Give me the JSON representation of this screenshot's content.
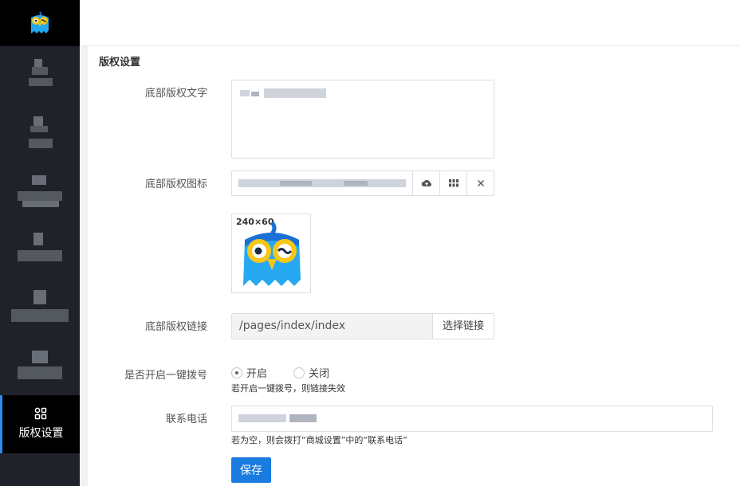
{
  "sidebar": {
    "active_item": {
      "label": "版权设置",
      "icon": "grid-icon"
    }
  },
  "section": {
    "title": "版权设置"
  },
  "form": {
    "copyright_text": {
      "label": "底部版权文字"
    },
    "copyright_icon": {
      "label": "底部版权图标",
      "upload_icon": "cloud-upload-icon",
      "grid_icon": "grid-icon",
      "clear_icon": "close-icon"
    },
    "preview": {
      "size_text": "240×60"
    },
    "copyright_link": {
      "label": "底部版权链接",
      "value": "/pages/index/index",
      "choose_label": "选择链接"
    },
    "one_key_dial": {
      "label": "是否开启一键拨号",
      "option_on": "开启",
      "option_off": "关闭",
      "hint": "若开启一键拨号，则链接失效"
    },
    "phone": {
      "label": "联系电话",
      "hint": "若为空，则会拨打“商城设置”中的“联系电话”"
    },
    "save_label": "保存"
  },
  "colors": {
    "primary": "#1a7be0",
    "sidebar_bg": "#1f2229",
    "active_border": "#2d8cf0"
  }
}
